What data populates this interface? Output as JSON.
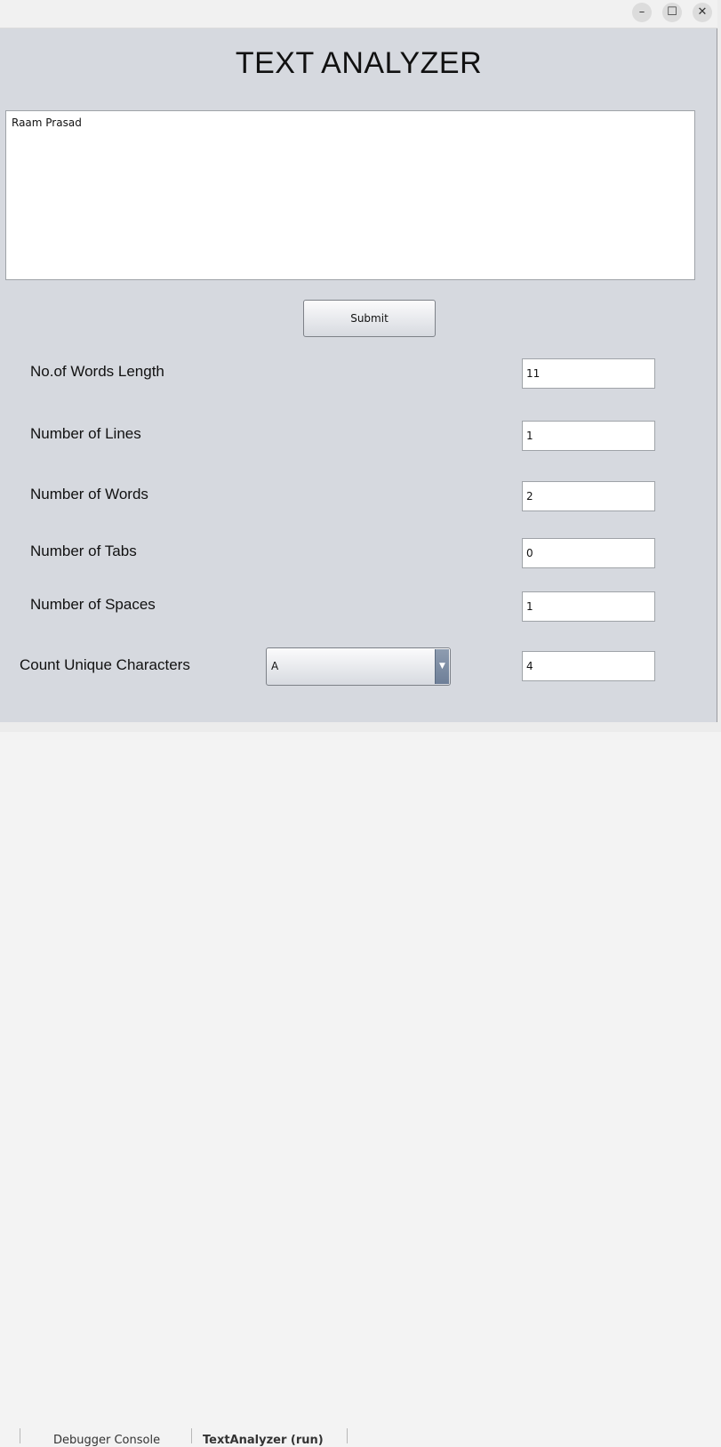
{
  "window": {
    "controls": {
      "minimize": "–",
      "maximize": "☐",
      "close": "✕"
    }
  },
  "title": "TEXT ANALYZER",
  "input": {
    "value": "Raam Prasad"
  },
  "submit_label": "Submit",
  "stats": [
    {
      "label": "No.of Words Length",
      "value": "11"
    },
    {
      "label": "Number of Lines",
      "value": "1"
    },
    {
      "label": "Number of Words",
      "value": "2"
    },
    {
      "label": "Number of Tabs",
      "value": "0"
    },
    {
      "label": "Number of Spaces",
      "value": "1"
    }
  ],
  "unique": {
    "label": "Count Unique Characters",
    "selected": "A",
    "value": "4"
  },
  "ide": {
    "tabs": [
      "Debugger Console",
      "TextAnalyzer (run)"
    ]
  }
}
